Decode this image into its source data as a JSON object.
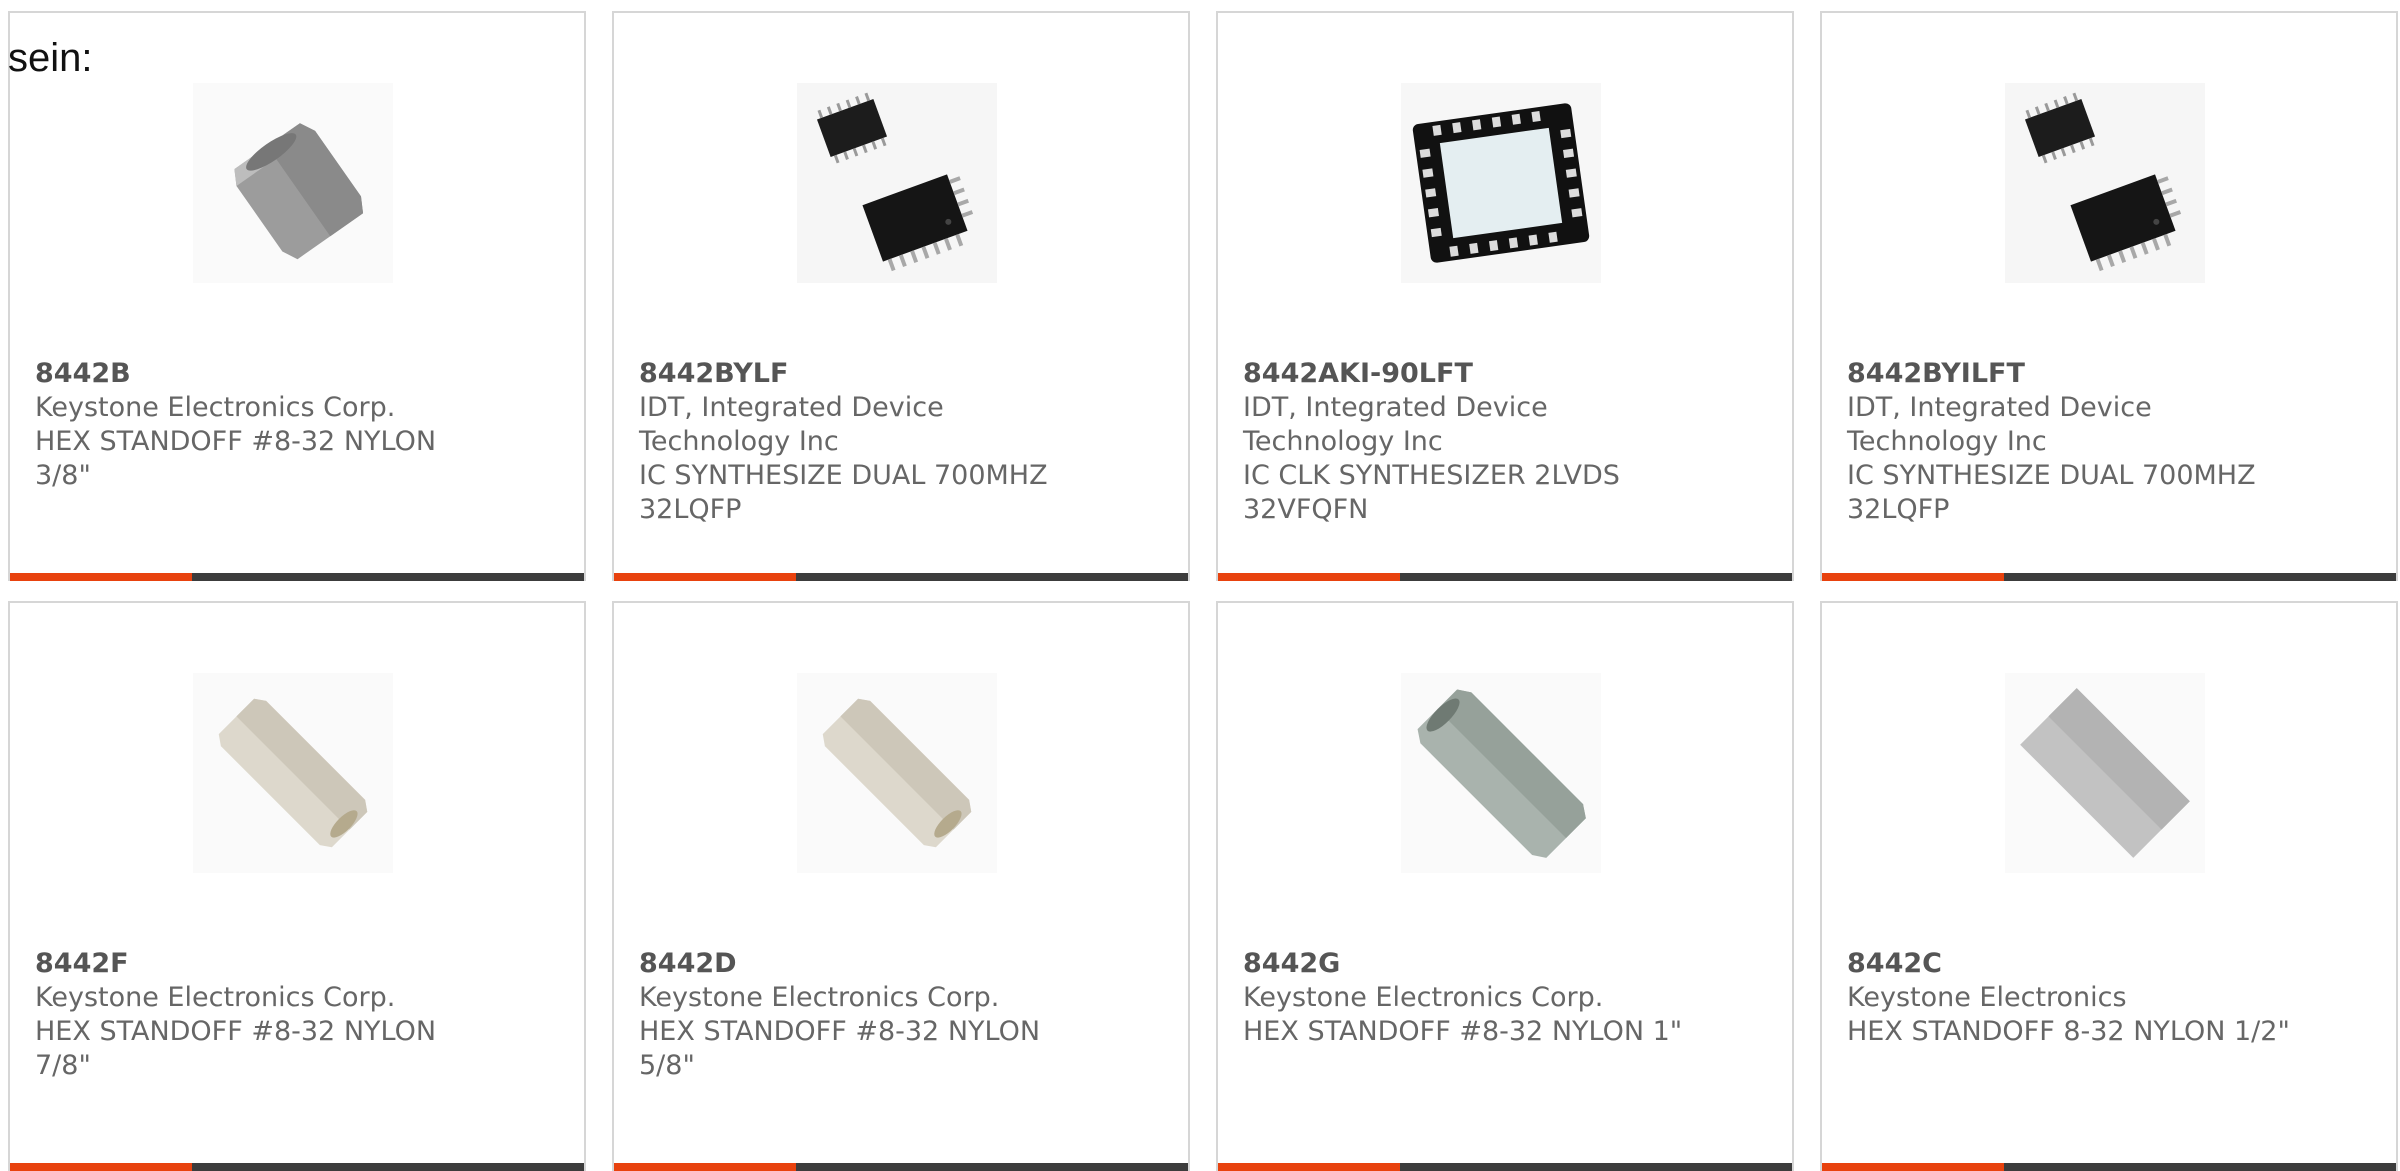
{
  "intro_text": "sein:",
  "colors": {
    "accent": "#e8420e",
    "bar_dark": "#3c3c3c"
  },
  "products": [
    {
      "part": "8442B",
      "lines": [
        "Keystone Electronics Corp.",
        "HEX STANDOFF #8-32 NYLON",
        "3/8\""
      ],
      "image": "gray-hex-standoff-short-icon"
    },
    {
      "part": "8442BYLF",
      "lines": [
        "IDT, Integrated Device",
        "Technology Inc",
        "IC SYNTHESIZE DUAL 700MHZ",
        "32LQFP"
      ],
      "image": "lqfp-chip-pair-icon"
    },
    {
      "part": "8442AKI-90LFT",
      "lines": [
        "IDT, Integrated Device",
        "Technology Inc",
        "IC CLK SYNTHESIZER 2LVDS",
        "32VFQFN"
      ],
      "image": "vfqfn-chip-icon"
    },
    {
      "part": "8442BYILFT",
      "lines": [
        "IDT, Integrated Device",
        "Technology Inc",
        "IC SYNTHESIZE DUAL 700MHZ",
        "32LQFP"
      ],
      "image": "lqfp-chip-pair-icon"
    },
    {
      "part": "8442F",
      "lines": [
        "Keystone Electronics Corp.",
        "HEX STANDOFF #8-32 NYLON",
        "7/8\""
      ],
      "image": "white-hex-standoff-icon"
    },
    {
      "part": "8442D",
      "lines": [
        "Keystone Electronics Corp.",
        "HEX STANDOFF #8-32 NYLON",
        "5/8\""
      ],
      "image": "white-hex-standoff-icon"
    },
    {
      "part": "8442G",
      "lines": [
        "Keystone Electronics Corp.",
        "HEX STANDOFF #8-32 NYLON 1\""
      ],
      "image": "gray-green-hex-standoff-icon"
    },
    {
      "part": "8442C",
      "lines": [
        "Keystone Electronics",
        "HEX STANDOFF 8-32 NYLON 1/2\""
      ],
      "image": "gray-hex-standoff-block-icon"
    }
  ]
}
